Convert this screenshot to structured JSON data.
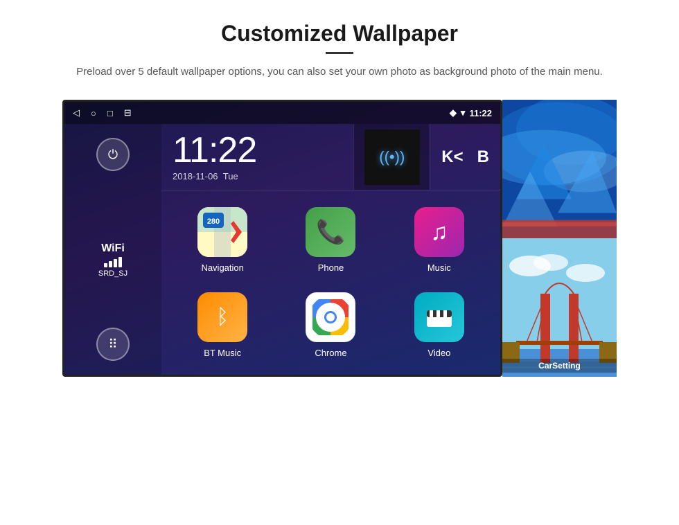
{
  "header": {
    "title": "Customized Wallpaper",
    "subtitle": "Preload over 5 default wallpaper options, you can also set your own photo as background photo of the main menu."
  },
  "statusBar": {
    "navIcons": [
      "◁",
      "○",
      "□",
      "⊟"
    ],
    "rightIcons": [
      "📍",
      "▾"
    ],
    "time": "11:22"
  },
  "sidebar": {
    "wifi": {
      "label": "WiFi",
      "ssid": "SRD_SJ"
    }
  },
  "timeWidget": {
    "time": "11:22",
    "date": "2018-11-06",
    "day": "Tue"
  },
  "extraIcons": [
    "K<",
    "B"
  ],
  "apps": [
    {
      "id": "navigation",
      "label": "Navigation",
      "type": "nav"
    },
    {
      "id": "phone",
      "label": "Phone",
      "type": "phone"
    },
    {
      "id": "music",
      "label": "Music",
      "type": "music"
    },
    {
      "id": "bt-music",
      "label": "BT Music",
      "type": "bt"
    },
    {
      "id": "chrome",
      "label": "Chrome",
      "type": "chrome"
    },
    {
      "id": "video",
      "label": "Video",
      "type": "video"
    }
  ],
  "wallpapers": [
    {
      "id": "ice",
      "type": "ice"
    },
    {
      "id": "bridge",
      "type": "bridge",
      "label": "CarSetting"
    }
  ]
}
